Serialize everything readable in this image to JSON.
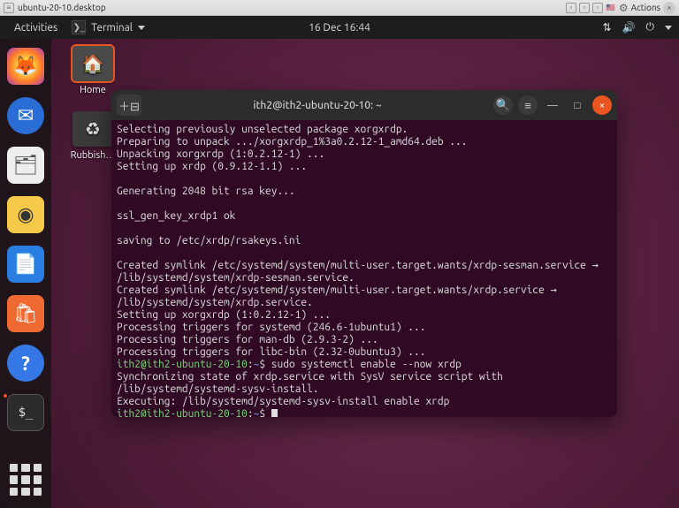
{
  "host": {
    "title": "ubuntu-20-10.desktop",
    "actions_label": "Actions"
  },
  "topbar": {
    "activities": "Activities",
    "app_name": "Terminal",
    "clock": "16 Dec  16:44"
  },
  "desktop_icons": {
    "home": "Home",
    "trash": "Rubbish…"
  },
  "terminal": {
    "title": "ith2@ith2-ubuntu-20-10: ~",
    "prompt_user": "ith2@ith2-ubuntu-20-10",
    "prompt_path": "~",
    "prompt_sep": ":",
    "prompt_end": "$",
    "cmd1": "sudo systemctl enable --now xrdp",
    "lines": [
      "Selecting previously unselected package xorgxrdp.",
      "Preparing to unpack .../xorgxrdp_1%3a0.2.12-1_amd64.deb ...",
      "Unpacking xorgxrdp (1:0.2.12-1) ...",
      "Setting up xrdp (0.9.12-1.1) ...",
      "",
      "Generating 2048 bit rsa key...",
      "",
      "ssl_gen_key_xrdp1 ok",
      "",
      "saving to /etc/xrdp/rsakeys.ini",
      "",
      "Created symlink /etc/systemd/system/multi-user.target.wants/xrdp-sesman.service → /lib/systemd/system/xrdp-sesman.service.",
      "Created symlink /etc/systemd/system/multi-user.target.wants/xrdp.service → /lib/systemd/system/xrdp.service.",
      "Setting up xorgxrdp (1:0.2.12-1) ...",
      "Processing triggers for systemd (246.6-1ubuntu1) ...",
      "Processing triggers for man-db (2.9.3-2) ...",
      "Processing triggers for libc-bin (2.32-0ubuntu3) ..."
    ],
    "lines2": [
      "Synchronizing state of xrdp.service with SysV service script with /lib/systemd/systemd-sysv-install.",
      "Executing: /lib/systemd/systemd-sysv-install enable xrdp"
    ]
  }
}
